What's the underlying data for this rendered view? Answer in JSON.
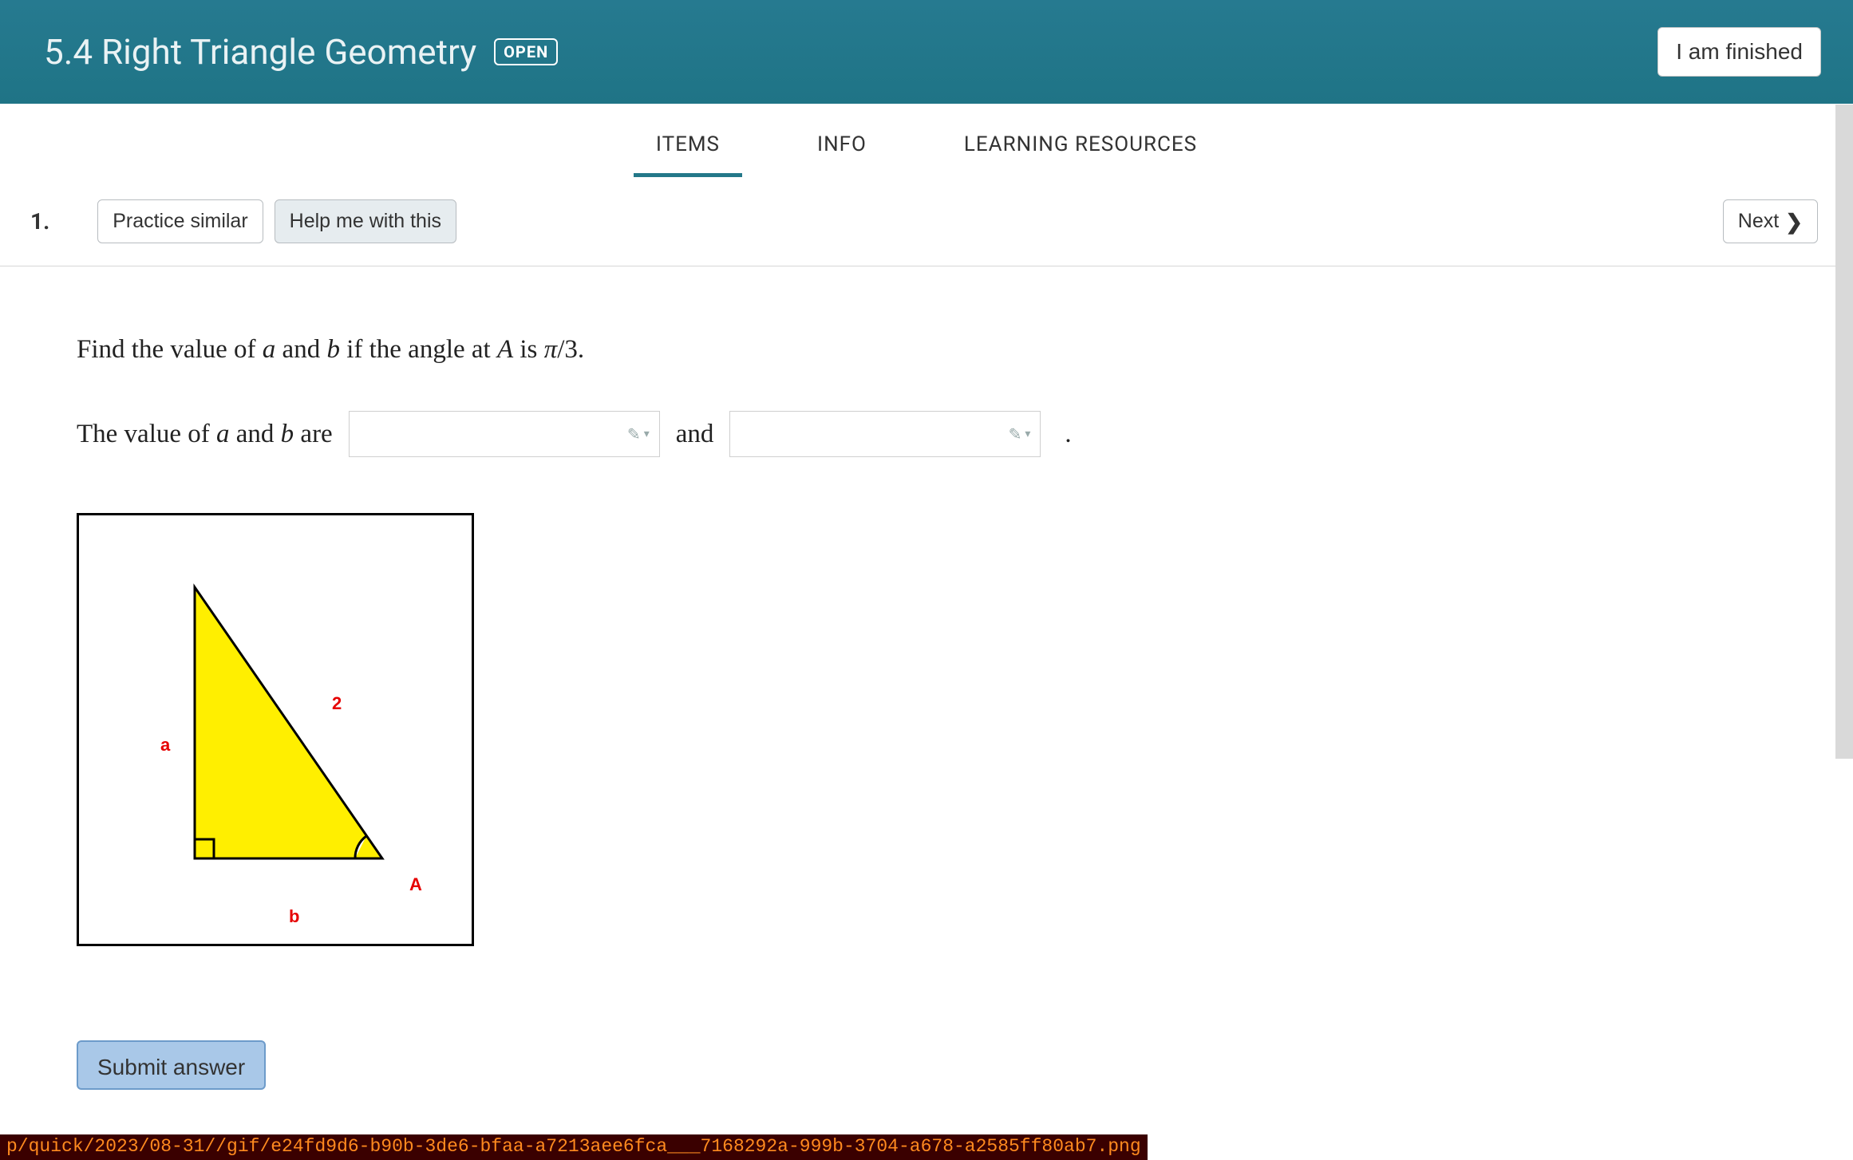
{
  "header": {
    "title": "5.4 Right Triangle Geometry",
    "badge": "OPEN",
    "finish_label": "I am finished"
  },
  "tabs": {
    "items": "ITEMS",
    "info": "INFO",
    "resources": "LEARNING RESOURCES",
    "active": "items"
  },
  "subbar": {
    "number": "1.",
    "practice_label": "Practice similar",
    "help_label": "Help me with this",
    "next_label": "Next"
  },
  "problem": {
    "prompt_prefix": "Find the value of ",
    "var_a": "a",
    "and1": " and ",
    "var_b": "b",
    "mid": " if the angle at ",
    "var_A": "A",
    "is": " is ",
    "pi": "π",
    "over3": "/3",
    "dot": ".",
    "answer_prefix": "The value of ",
    "are": " are",
    "and_word": "and"
  },
  "figure": {
    "hypotenuse_label": "2",
    "side_a": "a",
    "side_b": "b",
    "angle_A": "A"
  },
  "submit": {
    "label": "Submit answer"
  },
  "status_path": "p/quick/2023/08-31//gif/e24fd9d6-b90b-3de6-bfaa-a7213aee6fca___7168292a-999b-3704-a678-a2585ff80ab7.png"
}
